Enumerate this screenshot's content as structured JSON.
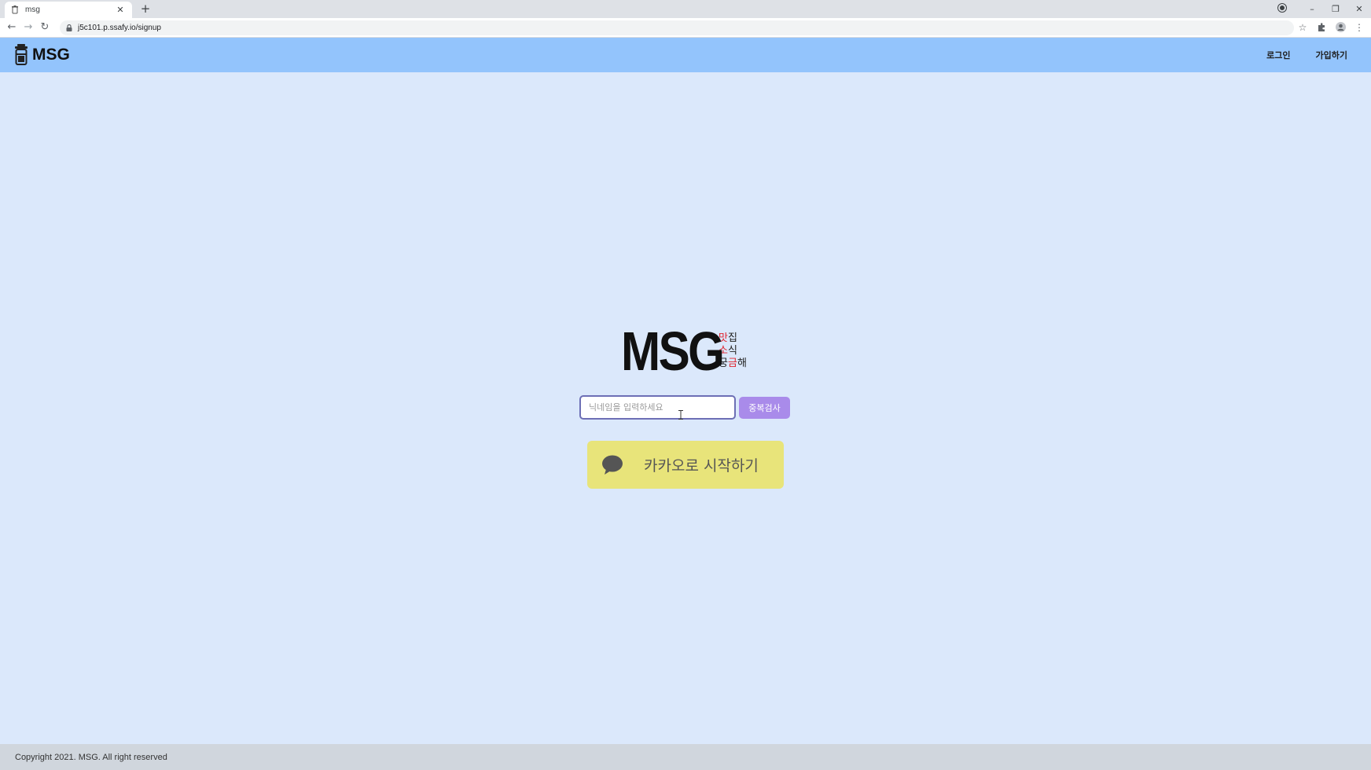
{
  "browser": {
    "tab_title": "msg",
    "tab_close": "✕",
    "new_tab": "+",
    "url": "j5c101.p.ssafy.io/signup",
    "nav": {
      "back": "←",
      "forward": "→",
      "reload": "↻"
    },
    "window": {
      "minimize": "–",
      "restore": "❐",
      "close": "✕"
    }
  },
  "header": {
    "logo_text": "MSG",
    "nav": {
      "login": "로그인",
      "signup": "가입하기"
    },
    "background": "#93c4fc"
  },
  "brand": {
    "title": "MSG",
    "tagline": {
      "line1_a": "맛",
      "line1_b": "집",
      "line2_a": "소",
      "line2_b": "식",
      "line3_a": "궁",
      "line3_b": "금",
      "line3_c": "해"
    },
    "highlight_color": "#e0252f"
  },
  "signup": {
    "nickname_placeholder": "닉네임을 입력하세요",
    "nickname_value": "",
    "duplicate_check_label": "중복검사",
    "kakao_label": "카카오로 시작하기"
  },
  "footer": {
    "copyright": "Copyright 2021. MSG. All right reserved"
  },
  "colors": {
    "page_background": "#dbe8fb",
    "kakao_button": "#e8e47a",
    "duplicate_button": "#a98bea",
    "footer_background": "#d0d6dd"
  }
}
